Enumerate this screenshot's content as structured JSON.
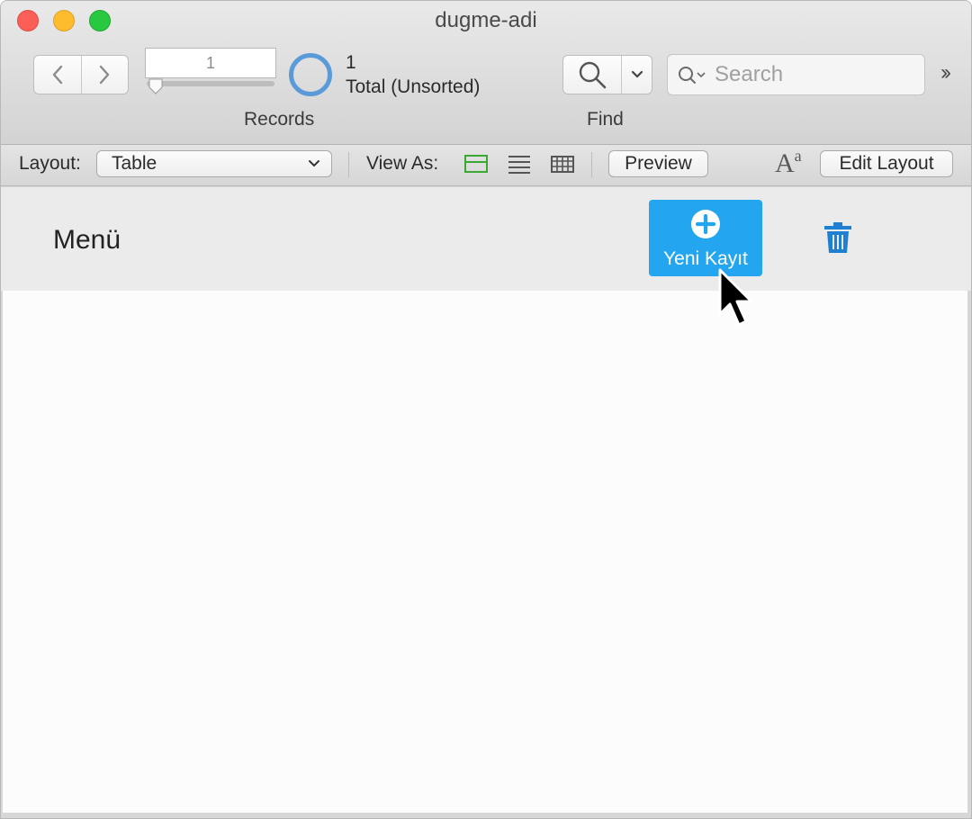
{
  "window": {
    "title": "dugme-adi"
  },
  "toolbar": {
    "records": {
      "current": "1",
      "found": "1",
      "total_text": "Total (Unsorted)",
      "label": "Records",
      "progress": 0.0
    },
    "find": {
      "label": "Find"
    },
    "search": {
      "placeholder": "Search"
    }
  },
  "status_toolbar": {
    "layout_label": "Layout:",
    "layout_value": "Table",
    "view_as_label": "View As:",
    "preview_label": "Preview",
    "edit_layout_label": "Edit Layout",
    "font_icon_text": {
      "big": "A",
      "small": "a"
    }
  },
  "layout_header": {
    "title": "Menü",
    "new_record_label": "Yeni Kayıt"
  },
  "colors": {
    "accent_blue": "#23a6ef",
    "ring_blue": "#5b9ad9",
    "trash_blue": "#1f7fd0",
    "form_view_green": "#3aa832"
  },
  "icons": [
    "back-icon",
    "forward-icon",
    "magnifier-icon",
    "chevron-down-icon",
    "search-icon",
    "overflow-chevrons-icon",
    "form-view-icon",
    "list-view-icon",
    "table-view-icon",
    "font-size-icon",
    "plus-circle-icon",
    "trash-icon",
    "mouse-cursor-icon"
  ]
}
